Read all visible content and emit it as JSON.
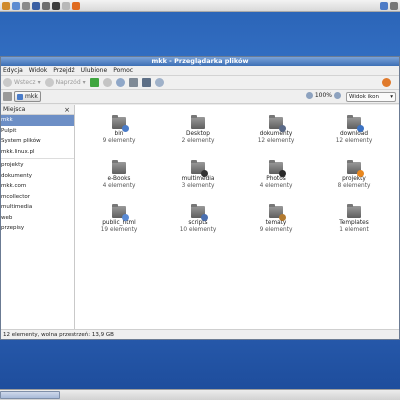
{
  "window": {
    "title": "mkk - Przeglądarka plików"
  },
  "menu": [
    "Edycja",
    "Widok",
    "Przejdź",
    "Ulubione",
    "Pomoc"
  ],
  "toolbar": {
    "back_label": "Wstecz",
    "forward_label": "Naprzód"
  },
  "location": {
    "path_label": "mkk",
    "zoom": "100%",
    "view_mode": "Widok ikon"
  },
  "sidebar": {
    "header": "Miejsca",
    "items": [
      {
        "label": "mkk",
        "selected": true
      },
      {
        "label": "Pulpit"
      },
      {
        "label": "System plików"
      },
      {
        "label": "mkk.linux.pl",
        "separator_after": true
      },
      {
        "label": "projekty"
      },
      {
        "label": "dokumenty"
      },
      {
        "label": "mkk.com"
      },
      {
        "label": "mcollector"
      },
      {
        "label": "multimedia"
      },
      {
        "label": "web"
      },
      {
        "label": "przepisy"
      }
    ]
  },
  "files": [
    {
      "name": "bin",
      "count": "9 elementy",
      "emblem": "#4a7cc9"
    },
    {
      "name": "Desktop",
      "count": "2 elementy",
      "emblem": ""
    },
    {
      "name": "dokumenty",
      "count": "12 elementy",
      "emblem": "#5b6a88"
    },
    {
      "name": "download",
      "count": "12 elementy",
      "emblem": "#3c73c4"
    },
    {
      "name": "e-Books",
      "count": "4 elementy",
      "emblem": ""
    },
    {
      "name": "multimedia",
      "count": "3 elementy",
      "emblem": "#333333"
    },
    {
      "name": "Photos",
      "count": "4 elementy",
      "emblem": "#2a2a2a"
    },
    {
      "name": "projekty",
      "count": "8 elementy",
      "emblem": "#e8871e"
    },
    {
      "name": "public_html",
      "count": "19 elementy",
      "emblem": "#5a8ad4"
    },
    {
      "name": "scripts",
      "count": "10 elementy",
      "emblem": "#4a6fb0"
    },
    {
      "name": "tematy",
      "count": "9 elementy",
      "emblem": "#b37a2f"
    },
    {
      "name": "Templates",
      "count": "1 element",
      "emblem": ""
    }
  ],
  "status": "12 elementy, wolna przestrzeń: 13,9 GB",
  "colors": {
    "accent": "#3d6fb5",
    "selection": "#6d8fc6"
  }
}
